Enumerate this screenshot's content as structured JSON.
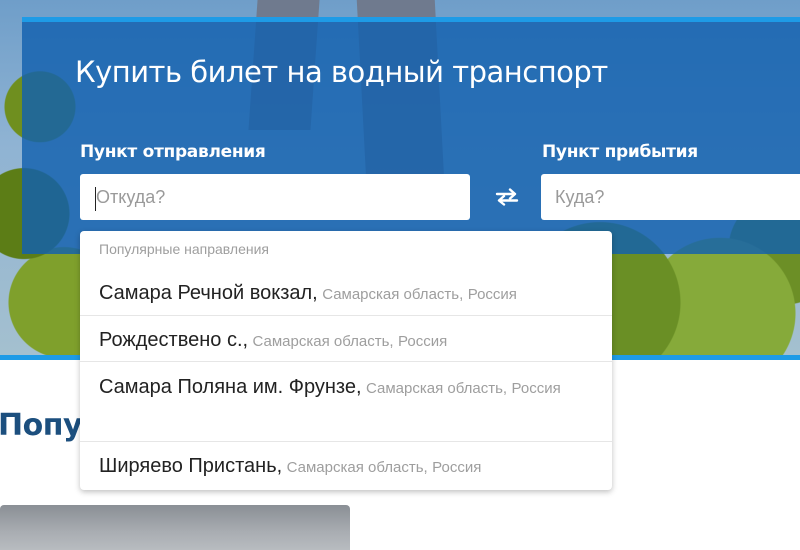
{
  "panel": {
    "title": "Купить билет на водный транспорт",
    "from_label": "Пункт отправления",
    "from_placeholder": "Откуда?",
    "from_value": "",
    "to_label": "Пункт прибытия",
    "to_placeholder": "Куда?",
    "to_value": "",
    "swap_icon": "swap-arrows-icon"
  },
  "dropdown": {
    "heading": "Популярные направления",
    "options": [
      {
        "name": "Самара Речной вокзал,",
        "region": "Самарская область,",
        "country": "Россия"
      },
      {
        "name": "Рождествено с.,",
        "region": "Самарская область,",
        "country": "Россия"
      },
      {
        "name": "Самара Поляна им. Фрунзе,",
        "region": "Самарская область,",
        "country": "Россия"
      },
      {
        "name": "Ширяево Пристань,",
        "region": "Самарская область,",
        "country": "Россия"
      }
    ]
  },
  "section": {
    "title": "Популя"
  },
  "colors": {
    "accent": "#1e9be6",
    "panel": "#1260af",
    "heading": "#1c4f7e"
  }
}
